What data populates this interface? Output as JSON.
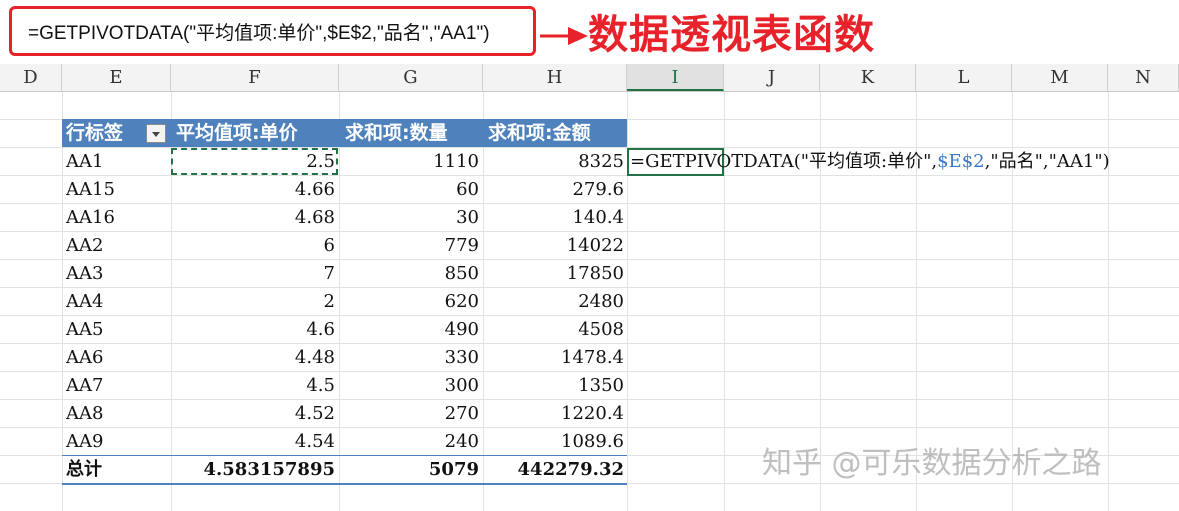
{
  "formula_bar": {
    "formula": "=GETPIVOTDATA(\"平均值项:单价\",$E$2,\"品名\",\"AA1\")"
  },
  "annotation": {
    "caption": "数据透视表函数",
    "color": "#e8222a"
  },
  "columns": [
    "D",
    "E",
    "F",
    "G",
    "H",
    "I",
    "J",
    "K",
    "L",
    "M",
    "N"
  ],
  "selected_column": "I",
  "pivot": {
    "header_color": "#4f81bd",
    "headers": {
      "row_label": "行标签",
      "avg_price": "平均值项:单价",
      "sum_qty": "求和项:数量",
      "sum_amount": "求和项:金额"
    },
    "rows": [
      {
        "name": "AA1",
        "price": "2.5",
        "qty": "1110",
        "amount": "8325"
      },
      {
        "name": "AA15",
        "price": "4.66",
        "qty": "60",
        "amount": "279.6"
      },
      {
        "name": "AA16",
        "price": "4.68",
        "qty": "30",
        "amount": "140.4"
      },
      {
        "name": "AA2",
        "price": "6",
        "qty": "779",
        "amount": "14022"
      },
      {
        "name": "AA3",
        "price": "7",
        "qty": "850",
        "amount": "17850"
      },
      {
        "name": "AA4",
        "price": "2",
        "qty": "620",
        "amount": "2480"
      },
      {
        "name": "AA5",
        "price": "4.6",
        "qty": "490",
        "amount": "4508"
      },
      {
        "name": "AA6",
        "price": "4.48",
        "qty": "330",
        "amount": "1478.4"
      },
      {
        "name": "AA7",
        "price": "4.5",
        "qty": "300",
        "amount": "1350"
      },
      {
        "name": "AA8",
        "price": "4.52",
        "qty": "270",
        "amount": "1220.4"
      },
      {
        "name": "AA9",
        "price": "4.54",
        "qty": "240",
        "amount": "1089.6"
      }
    ],
    "total": {
      "name": "总计",
      "price": "4.583157895",
      "qty": "5079",
      "amount": "442279.32"
    }
  },
  "cell_formula": {
    "prefix": "=GETPIVOTDATA(\"平均值项:单价\",",
    "ref": "$E$2",
    "suffix": ",\"品名\",\"AA1\")"
  },
  "watermark": "知乎 @可乐数据分析之路"
}
